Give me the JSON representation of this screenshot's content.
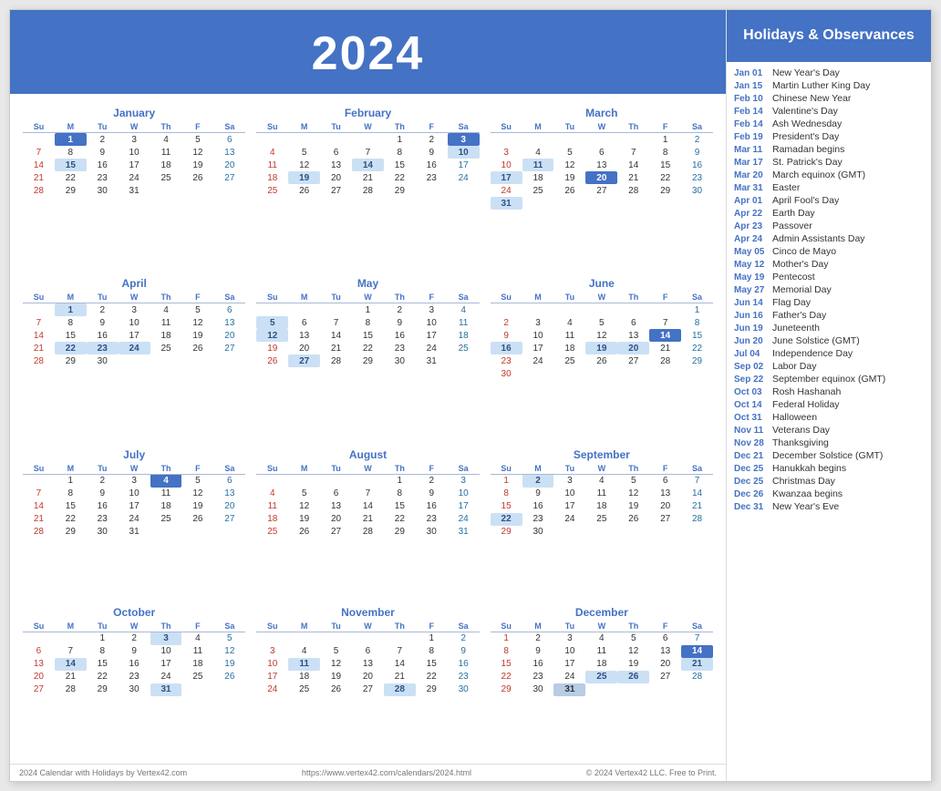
{
  "year": "2024",
  "title": "Holidays & Observances",
  "footer": {
    "left": "2024 Calendar with Holidays by Vertex42.com",
    "center": "https://www.vertex42.com/calendars/2024.html",
    "right": "© 2024 Vertex42 LLC. Free to Print."
  },
  "months": [
    {
      "name": "January",
      "weeks": [
        [
          "",
          "1",
          "2",
          "3",
          "4",
          "5",
          "6"
        ],
        [
          "7",
          "8",
          "9",
          "10",
          "11",
          "12",
          "13"
        ],
        [
          "14",
          "15",
          "16",
          "17",
          "18",
          "19",
          "20"
        ],
        [
          "21",
          "22",
          "23",
          "24",
          "25",
          "26",
          "27"
        ],
        [
          "28",
          "29",
          "30",
          "31",
          "",
          "",
          ""
        ]
      ],
      "highlights": {
        "dark": [
          "1"
        ],
        "blue": [
          "15"
        ],
        "today": []
      }
    },
    {
      "name": "February",
      "weeks": [
        [
          "",
          "",
          "",
          "",
          "1",
          "2",
          "3"
        ],
        [
          "4",
          "5",
          "6",
          "7",
          "8",
          "9",
          "10"
        ],
        [
          "11",
          "12",
          "13",
          "14",
          "15",
          "16",
          "17"
        ],
        [
          "18",
          "19",
          "20",
          "21",
          "22",
          "23",
          "24"
        ],
        [
          "25",
          "26",
          "27",
          "28",
          "29",
          "",
          ""
        ]
      ],
      "highlights": {
        "dark": [
          "3"
        ],
        "blue": [
          "10",
          "14",
          "19"
        ],
        "today": []
      }
    },
    {
      "name": "March",
      "weeks": [
        [
          "",
          "",
          "",
          "",
          "",
          "1",
          "2"
        ],
        [
          "3",
          "4",
          "5",
          "6",
          "7",
          "8",
          "9"
        ],
        [
          "10",
          "11",
          "12",
          "13",
          "14",
          "15",
          "16"
        ],
        [
          "17",
          "18",
          "19",
          "20",
          "21",
          "22",
          "23"
        ],
        [
          "24",
          "25",
          "26",
          "27",
          "28",
          "29",
          "30"
        ],
        [
          "31",
          "",
          "",
          "",
          "",
          "",
          ""
        ]
      ],
      "highlights": {
        "dark": [
          "20"
        ],
        "blue": [
          "11",
          "17",
          "31"
        ],
        "today": []
      }
    },
    {
      "name": "April",
      "weeks": [
        [
          "",
          "1",
          "2",
          "3",
          "4",
          "5",
          "6"
        ],
        [
          "7",
          "8",
          "9",
          "10",
          "11",
          "12",
          "13"
        ],
        [
          "14",
          "15",
          "16",
          "17",
          "18",
          "19",
          "20"
        ],
        [
          "21",
          "22",
          "23",
          "24",
          "25",
          "26",
          "27"
        ],
        [
          "28",
          "29",
          "30",
          "",
          "",
          "",
          ""
        ]
      ],
      "highlights": {
        "dark": [],
        "blue": [
          "1",
          "22",
          "23",
          "24"
        ],
        "today": []
      }
    },
    {
      "name": "May",
      "weeks": [
        [
          "",
          "",
          "",
          "1",
          "2",
          "3",
          "4"
        ],
        [
          "5",
          "6",
          "7",
          "8",
          "9",
          "10",
          "11"
        ],
        [
          "12",
          "13",
          "14",
          "15",
          "16",
          "17",
          "18"
        ],
        [
          "19",
          "20",
          "21",
          "22",
          "23",
          "24",
          "25"
        ],
        [
          "26",
          "27",
          "28",
          "29",
          "30",
          "31",
          ""
        ]
      ],
      "highlights": {
        "dark": [],
        "blue": [
          "5",
          "12",
          "27"
        ],
        "today": []
      }
    },
    {
      "name": "June",
      "weeks": [
        [
          "",
          "",
          "",
          "",
          "",
          "",
          "1"
        ],
        [
          "2",
          "3",
          "4",
          "5",
          "6",
          "7",
          "8"
        ],
        [
          "9",
          "10",
          "11",
          "12",
          "13",
          "14",
          "15"
        ],
        [
          "16",
          "17",
          "18",
          "19",
          "20",
          "21",
          "22"
        ],
        [
          "23",
          "24",
          "25",
          "26",
          "27",
          "28",
          "29"
        ],
        [
          "30",
          "",
          "",
          "",
          "",
          "",
          ""
        ]
      ],
      "highlights": {
        "dark": [
          "14"
        ],
        "blue": [
          "16",
          "19",
          "20"
        ],
        "today": []
      }
    },
    {
      "name": "July",
      "weeks": [
        [
          "",
          "1",
          "2",
          "3",
          "4",
          "5",
          "6"
        ],
        [
          "7",
          "8",
          "9",
          "10",
          "11",
          "12",
          "13"
        ],
        [
          "14",
          "15",
          "16",
          "17",
          "18",
          "19",
          "20"
        ],
        [
          "21",
          "22",
          "23",
          "24",
          "25",
          "26",
          "27"
        ],
        [
          "28",
          "29",
          "30",
          "31",
          "",
          "",
          ""
        ]
      ],
      "highlights": {
        "dark": [
          "4"
        ],
        "blue": [],
        "today": []
      }
    },
    {
      "name": "August",
      "weeks": [
        [
          "",
          "",
          "",
          "",
          "1",
          "2",
          "3"
        ],
        [
          "4",
          "5",
          "6",
          "7",
          "8",
          "9",
          "10"
        ],
        [
          "11",
          "12",
          "13",
          "14",
          "15",
          "16",
          "17"
        ],
        [
          "18",
          "19",
          "20",
          "21",
          "22",
          "23",
          "24"
        ],
        [
          "25",
          "26",
          "27",
          "28",
          "29",
          "30",
          "31"
        ]
      ],
      "highlights": {
        "dark": [],
        "blue": [],
        "today": []
      }
    },
    {
      "name": "September",
      "weeks": [
        [
          "1",
          "2",
          "3",
          "4",
          "5",
          "6",
          "7"
        ],
        [
          "8",
          "9",
          "10",
          "11",
          "12",
          "13",
          "14"
        ],
        [
          "15",
          "16",
          "17",
          "18",
          "19",
          "20",
          "21"
        ],
        [
          "22",
          "23",
          "24",
          "25",
          "26",
          "27",
          "28"
        ],
        [
          "29",
          "30",
          "",
          "",
          "",
          "",
          ""
        ]
      ],
      "highlights": {
        "dark": [],
        "blue": [
          "2",
          "22"
        ],
        "today": []
      }
    },
    {
      "name": "October",
      "weeks": [
        [
          "",
          "",
          "1",
          "2",
          "3",
          "4",
          "5"
        ],
        [
          "6",
          "7",
          "8",
          "9",
          "10",
          "11",
          "12"
        ],
        [
          "13",
          "14",
          "15",
          "16",
          "17",
          "18",
          "19"
        ],
        [
          "20",
          "21",
          "22",
          "23",
          "24",
          "25",
          "26"
        ],
        [
          "27",
          "28",
          "29",
          "30",
          "31",
          "",
          ""
        ]
      ],
      "highlights": {
        "dark": [],
        "blue": [
          "3",
          "14",
          "31"
        ],
        "today": []
      }
    },
    {
      "name": "November",
      "weeks": [
        [
          "",
          "",
          "",
          "",
          "",
          "1",
          "2"
        ],
        [
          "3",
          "4",
          "5",
          "6",
          "7",
          "8",
          "9"
        ],
        [
          "10",
          "11",
          "12",
          "13",
          "14",
          "15",
          "16"
        ],
        [
          "17",
          "18",
          "19",
          "20",
          "21",
          "22",
          "23"
        ],
        [
          "24",
          "25",
          "26",
          "27",
          "28",
          "29",
          "30"
        ]
      ],
      "highlights": {
        "dark": [],
        "blue": [
          "11",
          "28"
        ],
        "today": []
      }
    },
    {
      "name": "December",
      "weeks": [
        [
          "1",
          "2",
          "3",
          "4",
          "5",
          "6",
          "7"
        ],
        [
          "8",
          "9",
          "10",
          "11",
          "12",
          "13",
          "14"
        ],
        [
          "15",
          "16",
          "17",
          "18",
          "19",
          "20",
          "21"
        ],
        [
          "22",
          "23",
          "24",
          "25",
          "26",
          "27",
          "28"
        ],
        [
          "29",
          "30",
          "31",
          "",
          "",
          "",
          ""
        ]
      ],
      "highlights": {
        "dark": [
          "14"
        ],
        "blue": [
          "21",
          "25",
          "26"
        ],
        "today": [
          "25",
          "31"
        ]
      }
    }
  ],
  "holidays": [
    {
      "date": "Jan 01",
      "name": "New Year's Day"
    },
    {
      "date": "Jan 15",
      "name": "Martin Luther King Day"
    },
    {
      "date": "Feb 10",
      "name": "Chinese New Year"
    },
    {
      "date": "Feb 14",
      "name": "Valentine's Day"
    },
    {
      "date": "Feb 14",
      "name": "Ash Wednesday"
    },
    {
      "date": "Feb 19",
      "name": "President's Day"
    },
    {
      "date": "Mar 11",
      "name": "Ramadan begins"
    },
    {
      "date": "Mar 17",
      "name": "St. Patrick's Day"
    },
    {
      "date": "Mar 20",
      "name": "March equinox (GMT)"
    },
    {
      "date": "Mar 31",
      "name": "Easter"
    },
    {
      "date": "Apr 01",
      "name": "April Fool's Day"
    },
    {
      "date": "Apr 22",
      "name": "Earth Day"
    },
    {
      "date": "Apr 23",
      "name": "Passover"
    },
    {
      "date": "Apr 24",
      "name": "Admin Assistants Day"
    },
    {
      "date": "May 05",
      "name": "Cinco de Mayo"
    },
    {
      "date": "May 12",
      "name": "Mother's Day"
    },
    {
      "date": "May 19",
      "name": "Pentecost"
    },
    {
      "date": "May 27",
      "name": "Memorial Day"
    },
    {
      "date": "Jun 14",
      "name": "Flag Day"
    },
    {
      "date": "Jun 16",
      "name": "Father's Day"
    },
    {
      "date": "Jun 19",
      "name": "Juneteenth"
    },
    {
      "date": "Jun 20",
      "name": "June Solstice (GMT)"
    },
    {
      "date": "Jul 04",
      "name": "Independence Day"
    },
    {
      "date": "Sep 02",
      "name": "Labor Day"
    },
    {
      "date": "Sep 22",
      "name": "September equinox (GMT)"
    },
    {
      "date": "Oct 03",
      "name": "Rosh Hashanah"
    },
    {
      "date": "Oct 14",
      "name": "Federal Holiday"
    },
    {
      "date": "Oct 31",
      "name": "Halloween"
    },
    {
      "date": "Nov 11",
      "name": "Veterans Day"
    },
    {
      "date": "Nov 28",
      "name": "Thanksgiving"
    },
    {
      "date": "Dec 21",
      "name": "December Solstice (GMT)"
    },
    {
      "date": "Dec 25",
      "name": "Hanukkah begins"
    },
    {
      "date": "Dec 25",
      "name": "Christmas Day"
    },
    {
      "date": "Dec 26",
      "name": "Kwanzaa begins"
    },
    {
      "date": "Dec 31",
      "name": "New Year's Eve"
    }
  ]
}
